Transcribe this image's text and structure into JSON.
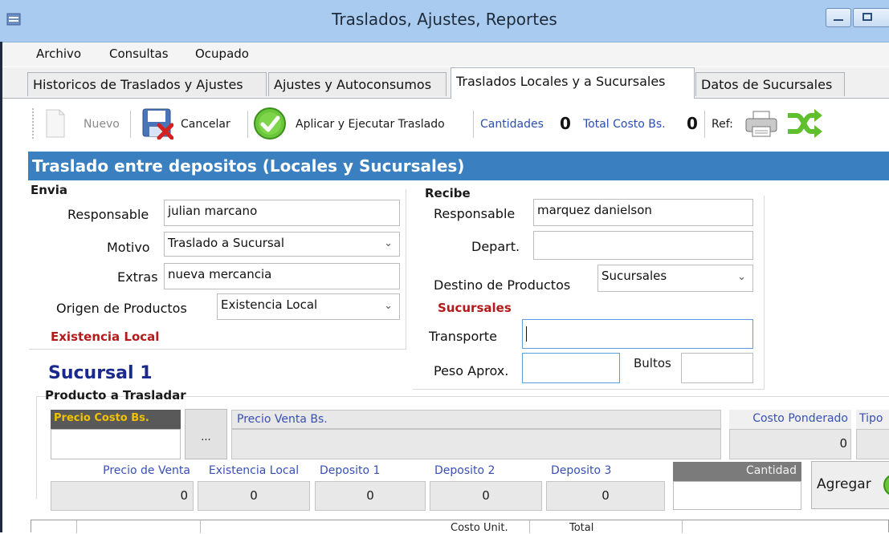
{
  "window": {
    "title": "Traslados, Ajustes, Reportes"
  },
  "menu": {
    "items": [
      "Archivo",
      "Consultas",
      "Ocupado"
    ]
  },
  "tabs": [
    "Historicos de Traslados y Ajustes",
    "Ajustes y Autoconsumos",
    "Traslados Locales y a Sucursales",
    "Datos de Sucursales"
  ],
  "toolbar": {
    "nuevo": "Nuevo",
    "cancelar": "Cancelar",
    "aplicar": "Aplicar y Ejecutar Traslado",
    "cantidades_label": "Cantidades",
    "cantidades_value": "0",
    "total_label": "Total Costo Bs.",
    "total_value": "0",
    "ref_label": "Ref:"
  },
  "section": {
    "title": "Traslado entre depositos (Locales y Sucursales)"
  },
  "envia": {
    "group": "Envia",
    "responsable_label": "Responsable",
    "responsable_value": "julian marcano",
    "motivo_label": "Motivo",
    "motivo_value": "Traslado a Sucursal",
    "extras_label": "Extras",
    "extras_value": "nueva mercancia",
    "origen_label": "Origen de Productos",
    "origen_value": "Existencia Local",
    "origen_note": "Existencia Local"
  },
  "recibe": {
    "group": "Recibe",
    "responsable_label": "Responsable",
    "responsable_value": "marquez danielson",
    "depart_label": "Depart.",
    "depart_value": "",
    "destino_label": "Destino de Productos",
    "destino_value": "Sucursales",
    "destino_note": "Sucursales",
    "transporte_label": "Transporte",
    "transporte_value": "",
    "peso_label": "Peso Aprox.",
    "peso_value": "",
    "bultos_label": "Bultos",
    "bultos_value": ""
  },
  "sucursal": {
    "name": "Sucursal 1"
  },
  "producto": {
    "group": "Producto a Trasladar",
    "precio_costo_label": "Precio Costo Bs.",
    "precio_costo_value": "",
    "ellipsis": "...",
    "precio_venta_bs_label": "Precio Venta Bs.",
    "costo_ponderado_label": "Costo Ponderado",
    "costo_ponderado_value": "0",
    "tipo_label": "Tipo",
    "precio_venta_label": "Precio de Venta",
    "precio_venta_value": "0",
    "existencia_label": "Existencia Local",
    "existencia_value": "0",
    "deposito1_label": "Deposito 1",
    "deposito1_value": "0",
    "deposito2_label": "Deposito 2",
    "deposito2_value": "0",
    "deposito3_label": "Deposito 3",
    "deposito3_value": "0",
    "cantidad_label": "Cantidad",
    "cantidad_value": "",
    "agregar": "Agregar"
  },
  "table": {
    "columns": [
      "",
      "",
      "",
      "Costo Unit.",
      "Total"
    ]
  },
  "colors": {
    "accent": "#3a7fbf",
    "titlebar": "#a8cbef",
    "red": "#b31b1b",
    "navy": "#1a2a8c",
    "gold": "#f2c200"
  }
}
